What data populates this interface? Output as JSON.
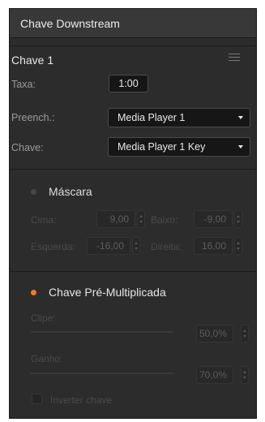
{
  "panel": {
    "title": "Chave Downstream"
  },
  "key": {
    "title": "Chave 1",
    "menu_icon": "hamburger-menu-icon"
  },
  "rate": {
    "label": "Taxa:",
    "value": "1:00"
  },
  "fill": {
    "label": "Preench.:",
    "value": "Media Player 1"
  },
  "keysource": {
    "label": "Chave:",
    "value": "Media Player 1 Key"
  },
  "mask": {
    "title": "Máscara",
    "enabled": false,
    "top": {
      "label": "Cima:",
      "value": "9,00"
    },
    "bottom": {
      "label": "Baixo:",
      "value": "-9,00"
    },
    "left": {
      "label": "Esquerda:",
      "value": "-16,00"
    },
    "right": {
      "label": "Direita:",
      "value": "16,00"
    }
  },
  "premult": {
    "title": "Chave Pré-Multiplicada",
    "enabled": true,
    "clip": {
      "label": "Clipe:",
      "value": "50,0%"
    },
    "gain": {
      "label": "Ganho:",
      "value": "70,0%"
    },
    "invert": {
      "label": "Inverter chave",
      "checked": false
    }
  },
  "colors": {
    "active_dot": "#f27a24",
    "inactive_dot": "#4a4a4a",
    "panel_bg": "#2c2c2c"
  }
}
